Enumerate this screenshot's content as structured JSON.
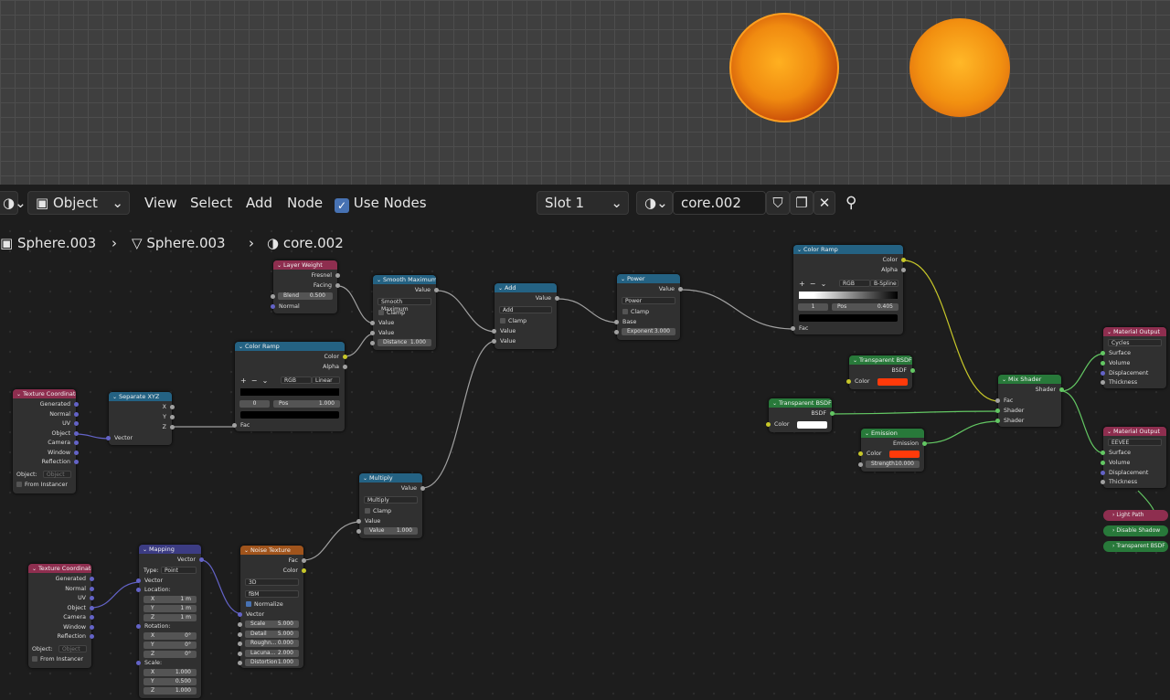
{
  "header": {
    "mode": "Object",
    "menu": [
      "View",
      "Select",
      "Add",
      "Node"
    ],
    "use_nodes": "Use Nodes",
    "slot": "Slot 1",
    "material": "core.002"
  },
  "breadcrumb": [
    "Sphere.003",
    "Sphere.003",
    "core.002"
  ],
  "nodes": {
    "layer_weight": {
      "title": "Layer Weight",
      "out1": "Fresnel",
      "out2": "Facing",
      "blend_label": "Blend",
      "blend": "0.500",
      "in1": "Normal"
    },
    "smooth_max": {
      "title": "Smooth Maximum",
      "out": "Value",
      "op": "Smooth Maximum",
      "clamp": "Clamp",
      "in1": "Value",
      "in2": "Value",
      "dist_label": "Distance",
      "dist": "1.000"
    },
    "add": {
      "title": "Add",
      "out": "Value",
      "op": "Add",
      "clamp": "Clamp",
      "in1": "Value",
      "in2": "Value"
    },
    "power": {
      "title": "Power",
      "out": "Value",
      "op": "Power",
      "clamp": "Clamp",
      "in1": "Base",
      "exp_label": "Exponent",
      "exp": "3.000"
    },
    "ramp_top": {
      "title": "Color Ramp",
      "out1": "Color",
      "out2": "Alpha",
      "mode": "RGB",
      "interp": "B-Spline",
      "idx": "1",
      "pos_label": "Pos",
      "pos": "0.405",
      "in": "Fac"
    },
    "ramp_mid": {
      "title": "Color Ramp",
      "out1": "Color",
      "out2": "Alpha",
      "mode": "RGB",
      "interp": "Linear",
      "idx": "0",
      "pos_label": "Pos",
      "pos": "1.000",
      "in": "Fac"
    },
    "texcoord1": {
      "title": "Texture Coordinate",
      "outs": [
        "Generated",
        "Normal",
        "UV",
        "Object",
        "Camera",
        "Window",
        "Reflection"
      ],
      "object_label": "Object:",
      "object_ph": "Object",
      "from_inst": "From Instancer"
    },
    "sep_xyz": {
      "title": "Separate XYZ",
      "outs": [
        "X",
        "Y",
        "Z"
      ],
      "in": "Vector"
    },
    "multiply": {
      "title": "Multiply",
      "out": "Value",
      "op": "Multiply",
      "clamp": "Clamp",
      "in1": "Value",
      "val_label": "Value",
      "val": "1.000"
    },
    "texcoord2": {
      "title": "Texture Coordinate",
      "outs": [
        "Generated",
        "Normal",
        "UV",
        "Object",
        "Camera",
        "Window",
        "Reflection"
      ],
      "object_label": "Object:",
      "object_ph": "Object",
      "from_inst": "From Instancer"
    },
    "mapping": {
      "title": "Mapping",
      "out": "Vector",
      "type_label": "Type:",
      "type": "Point",
      "in": "Vector",
      "loc": "Location:",
      "lx": "1 m",
      "ly": "1 m",
      "lz": "1 m",
      "rot": "Rotation:",
      "rx": "0°",
      "ry": "0°",
      "rz": "0°",
      "scl": "Scale:",
      "sx": "1.000",
      "sy": "0.500",
      "sz": "1.000"
    },
    "noise": {
      "title": "Noise Texture",
      "out1": "Fac",
      "out2": "Color",
      "dim": "3D",
      "type": "fBM",
      "normalize": "Normalize",
      "in": "Vector",
      "scale": "5.000",
      "detail": "5.000",
      "rough": "0.000",
      "lac": "2.000",
      "dist": "1.000",
      "scale_l": "Scale",
      "detail_l": "Detail",
      "rough_l": "Roughn...",
      "lac_l": "Lacuna...",
      "dist_l": "Distortion"
    },
    "transp1": {
      "title": "Transparent BSDF",
      "out": "BSDF",
      "color": "Color"
    },
    "transp2": {
      "title": "Transparent BSDF",
      "out": "BSDF",
      "color": "Color"
    },
    "emission": {
      "title": "Emission",
      "out": "Emission",
      "color": "Color",
      "str_label": "Strength",
      "str": "10.000"
    },
    "mix": {
      "title": "Mix Shader",
      "out": "Shader",
      "in1": "Fac",
      "in2": "Shader",
      "in3": "Shader"
    },
    "out_cycles": {
      "title": "Material Output",
      "target": "Cycles",
      "ins": [
        "Surface",
        "Volume",
        "Displacement",
        "Thickness"
      ]
    },
    "out_eevee": {
      "title": "Material Output",
      "target": "EEVEE",
      "ins": [
        "Surface",
        "Volume",
        "Displacement",
        "Thickness"
      ]
    },
    "light_path": "Light Path",
    "disable_shadow": "Disable Shadow",
    "transp3": "Transparent BSDF"
  },
  "colors": {
    "emission": "#ff3a0a",
    "transp_white": "#ffffff",
    "orange": "#f0900f"
  }
}
